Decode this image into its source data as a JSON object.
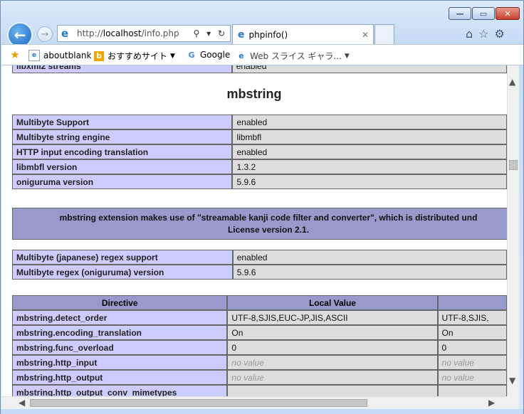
{
  "window": {
    "minimize": "—",
    "maximize": "▭",
    "close": "✕"
  },
  "nav": {
    "url_prefix": "http://",
    "url_host": "localhost",
    "url_path": "/info.php",
    "address_controls": "⚲ ▾ ↻"
  },
  "tab": {
    "title": "phpinfo()"
  },
  "favorites": [
    {
      "label": "aboutblank"
    },
    {
      "label": "おすすめサイト"
    },
    {
      "label": "Google"
    },
    {
      "label": "Web スライス ギャラ..."
    }
  ],
  "page": {
    "top_partial": {
      "name": "libxml2 streams",
      "value": "enabled"
    },
    "section_title": "mbstring",
    "table1": [
      {
        "name": "Multibyte Support",
        "value": "enabled"
      },
      {
        "name": "Multibyte string engine",
        "value": "libmbfl"
      },
      {
        "name": "HTTP input encoding translation",
        "value": "enabled"
      },
      {
        "name": "libmbfl version",
        "value": "1.3.2"
      },
      {
        "name": "oniguruma version",
        "value": "5.9.6"
      }
    ],
    "notice_line1": "mbstring extension makes use of \"streamable kanji code filter and converter\", which is distributed und",
    "notice_line2": "License version 2.1.",
    "table2": [
      {
        "name": "Multibyte (japanese) regex support",
        "value": "enabled"
      },
      {
        "name": "Multibyte regex (oniguruma) version",
        "value": "5.9.6"
      }
    ],
    "directives_header": {
      "directive": "Directive",
      "local": "Local Value",
      "master": ""
    },
    "directives": [
      {
        "name": "mbstring.detect_order",
        "local": "UTF-8,SJIS,EUC-JP,JIS,ASCII",
        "master": "UTF-8,SJIS,",
        "no_value": false
      },
      {
        "name": "mbstring.encoding_translation",
        "local": "On",
        "master": "On",
        "no_value": false
      },
      {
        "name": "mbstring.func_overload",
        "local": "0",
        "master": "0",
        "no_value": false
      },
      {
        "name": "mbstring.http_input",
        "local": "no value",
        "master": "no value",
        "no_value": true
      },
      {
        "name": "mbstring.http_output",
        "local": "no value",
        "master": "no value",
        "no_value": true
      },
      {
        "name": "mbstring.http_output_conv_mimetypes",
        "local": "",
        "master": "",
        "no_value": false
      }
    ]
  }
}
